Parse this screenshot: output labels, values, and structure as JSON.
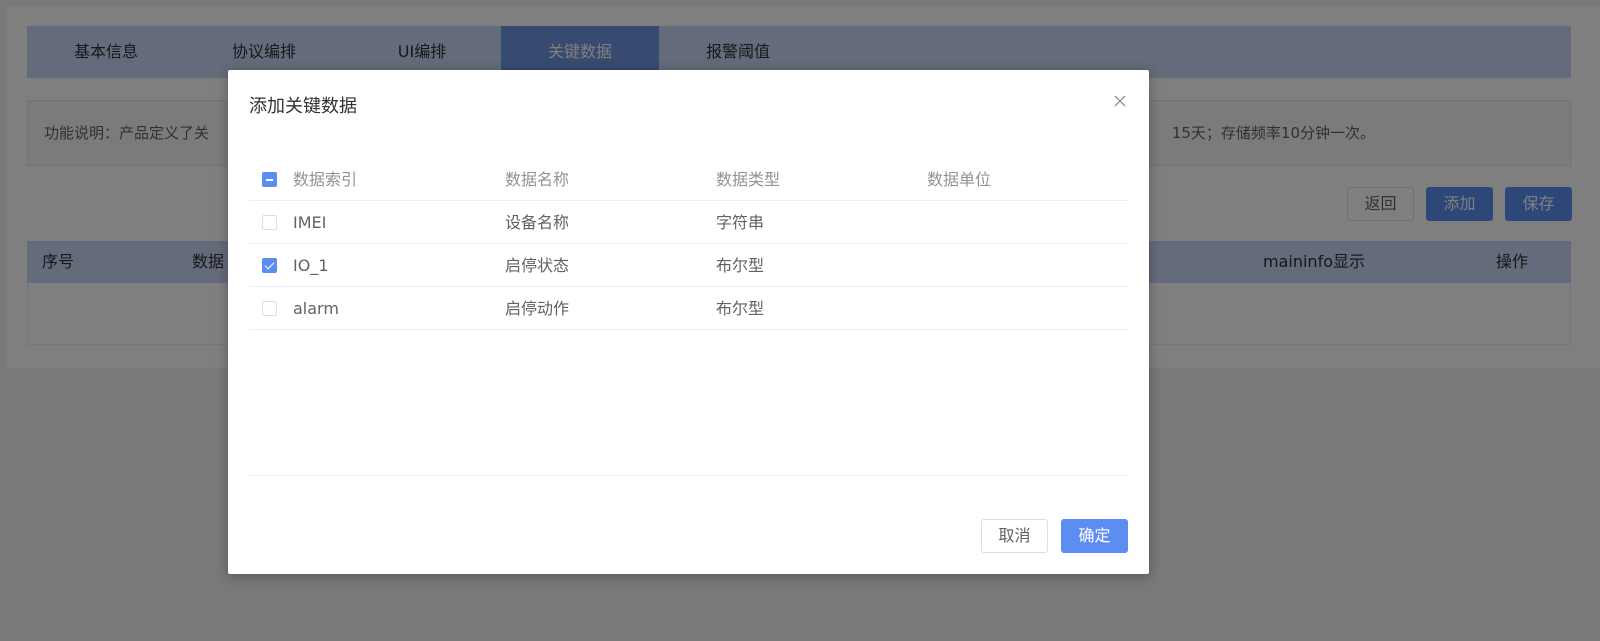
{
  "page": {
    "tabs": [
      {
        "label": "基本信息"
      },
      {
        "label": "协议编排"
      },
      {
        "label": "UI编排"
      },
      {
        "label": "关键数据"
      },
      {
        "label": "报警阈值"
      }
    ],
    "notice_left": "功能说明：产品定义了关",
    "notice_right": "15天；存储频率10分钟一次。",
    "buttons": {
      "back": "返回",
      "add": "添加",
      "save": "保存"
    },
    "table_headers": {
      "index": "序号",
      "data": "数据",
      "maininfo": "maininfo显示",
      "action": "操作"
    }
  },
  "dialog": {
    "title": "添加关键数据",
    "columns": [
      "数据索引",
      "数据名称",
      "数据类型",
      "数据单位"
    ],
    "rows": [
      {
        "index": "IMEI",
        "name": "设备名称",
        "type": "字符串",
        "unit": "",
        "checked": false
      },
      {
        "index": "IO_1",
        "name": "启停状态",
        "type": "布尔型",
        "unit": "",
        "checked": true
      },
      {
        "index": "alarm",
        "name": "启停动作",
        "type": "布尔型",
        "unit": "",
        "checked": false
      }
    ],
    "cancel_label": "取消",
    "ok_label": "确定"
  },
  "colors": {
    "primary": "#5b8ef0",
    "tab_bar": "#c9d6f5",
    "tab_active": "#6f95e0"
  }
}
